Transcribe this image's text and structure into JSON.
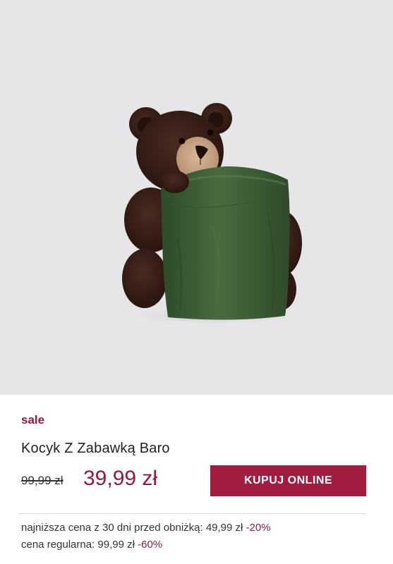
{
  "product": {
    "badge": "sale",
    "title": "Kocyk Z Zabawką Baro",
    "old_price": "99,99 zł",
    "price": "39,99 zł",
    "buy_label": "KUPUJ ONLINE"
  },
  "notes": {
    "lowest_label": "najniższa cena z 30 dni przed obniżką: 49,99 zł",
    "lowest_pct": "-20%",
    "regular_label": "cena regularna: 99,99 zł",
    "regular_pct": "-60%"
  },
  "colors": {
    "accent": "#a11d40",
    "price": "#8f1c3f",
    "image_bg": "#e6e6e8",
    "bear_brown": "#3a2118",
    "blanket_green": "#3f5e37"
  },
  "image": {
    "subject": "teddy-bear-with-green-blanket"
  }
}
